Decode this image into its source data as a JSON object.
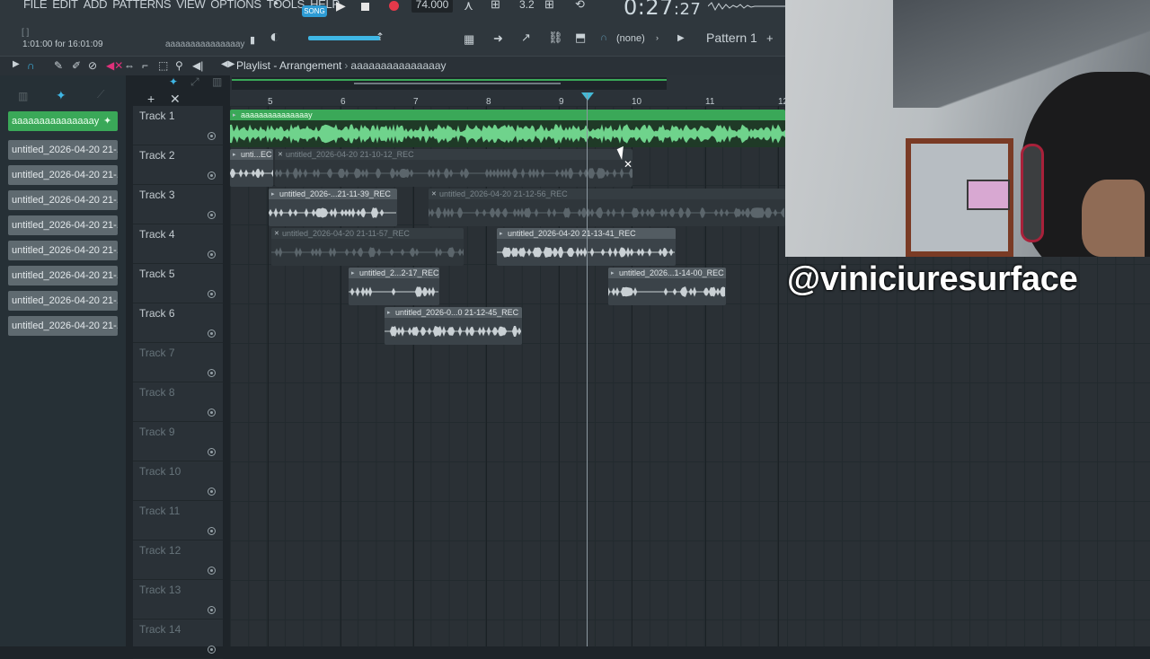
{
  "menu": [
    "FILE",
    "EDIT",
    "ADD",
    "PATTERNS",
    "VIEW",
    "OPTIONS",
    "TOOLS",
    "HELP"
  ],
  "transport": {
    "mode_label": "SONG",
    "tempo": "74.000",
    "time_main": "0:27",
    "time_sub": ":27",
    "snap_value": "3.2"
  },
  "hint": {
    "line1": "[  ]",
    "line2": "1:01:00 for 16:01:09",
    "name": "aaaaaaaaaaaaaaay"
  },
  "selectors": {
    "channel_none": "(none)",
    "pattern": "Pattern 1",
    "pattern_add": "+"
  },
  "playlist": {
    "title": "Playlist - Arrangement",
    "separator": "›",
    "pattern_name": "aaaaaaaaaaaaaaay"
  },
  "picker": {
    "items": [
      {
        "label": "aaaaaaaaaaaaaaay",
        "active": true
      },
      {
        "label": "untitled_2026-04-20 21-...",
        "active": false
      },
      {
        "label": "untitled_2026-04-20 21-...",
        "active": false
      },
      {
        "label": "untitled_2026-04-20 21-...",
        "active": false
      },
      {
        "label": "untitled_2026-04-20 21-...",
        "active": false
      },
      {
        "label": "untitled_2026-04-20 21-...",
        "active": false
      },
      {
        "label": "untitled_2026-04-20 21-...",
        "active": false
      },
      {
        "label": "untitled_2026-04-20 21-...",
        "active": false
      },
      {
        "label": "untitled_2026-04-20 21-...",
        "active": false
      }
    ]
  },
  "ruler": {
    "bars": [
      "5",
      "6",
      "7",
      "8",
      "9",
      "10",
      "11",
      "12"
    ]
  },
  "tracks": [
    {
      "name": "Track 1",
      "used": true
    },
    {
      "name": "Track 2",
      "used": true
    },
    {
      "name": "Track 3",
      "used": true
    },
    {
      "name": "Track 4",
      "used": true
    },
    {
      "name": "Track 5",
      "used": true
    },
    {
      "name": "Track 6",
      "used": true
    },
    {
      "name": "Track 7",
      "used": false
    },
    {
      "name": "Track 8",
      "used": false
    },
    {
      "name": "Track 9",
      "used": false
    },
    {
      "name": "Track 10",
      "used": false
    },
    {
      "name": "Track 11",
      "used": false
    },
    {
      "name": "Track 12",
      "used": false
    },
    {
      "name": "Track 13",
      "used": false
    },
    {
      "name": "Track 14",
      "used": false
    }
  ],
  "clips": [
    {
      "label": "aaaaaaaaaaaaaaay",
      "style": "green"
    },
    {
      "label": "unti...EC",
      "style": "grey"
    },
    {
      "label": "untitled_2026-04-20 21-10-12_REC",
      "style": "muted"
    },
    {
      "label": "untitled_2026-...21-11-39_REC",
      "style": "grey"
    },
    {
      "label": "untitled_2026-04-20 21-12-56_REC",
      "style": "muted"
    },
    {
      "label": "untitled_2026-04-20 21-11-57_REC",
      "style": "muted"
    },
    {
      "label": "untitled_2026-04-20 21-13-41_REC",
      "style": "grey"
    },
    {
      "label": "untitled_2...2-17_REC",
      "style": "grey"
    },
    {
      "label": "untitled_2026...1-14-00_REC",
      "style": "grey"
    },
    {
      "label": "untitled_2026-0...0 21-12-45_REC",
      "style": "grey"
    }
  ],
  "overlay": {
    "handle": "@viniciuresurface"
  },
  "colors": {
    "accent_green": "#3aa858",
    "accent_blue": "#2d9bd4",
    "record_red": "#e5394a",
    "background": "#1e2429"
  }
}
